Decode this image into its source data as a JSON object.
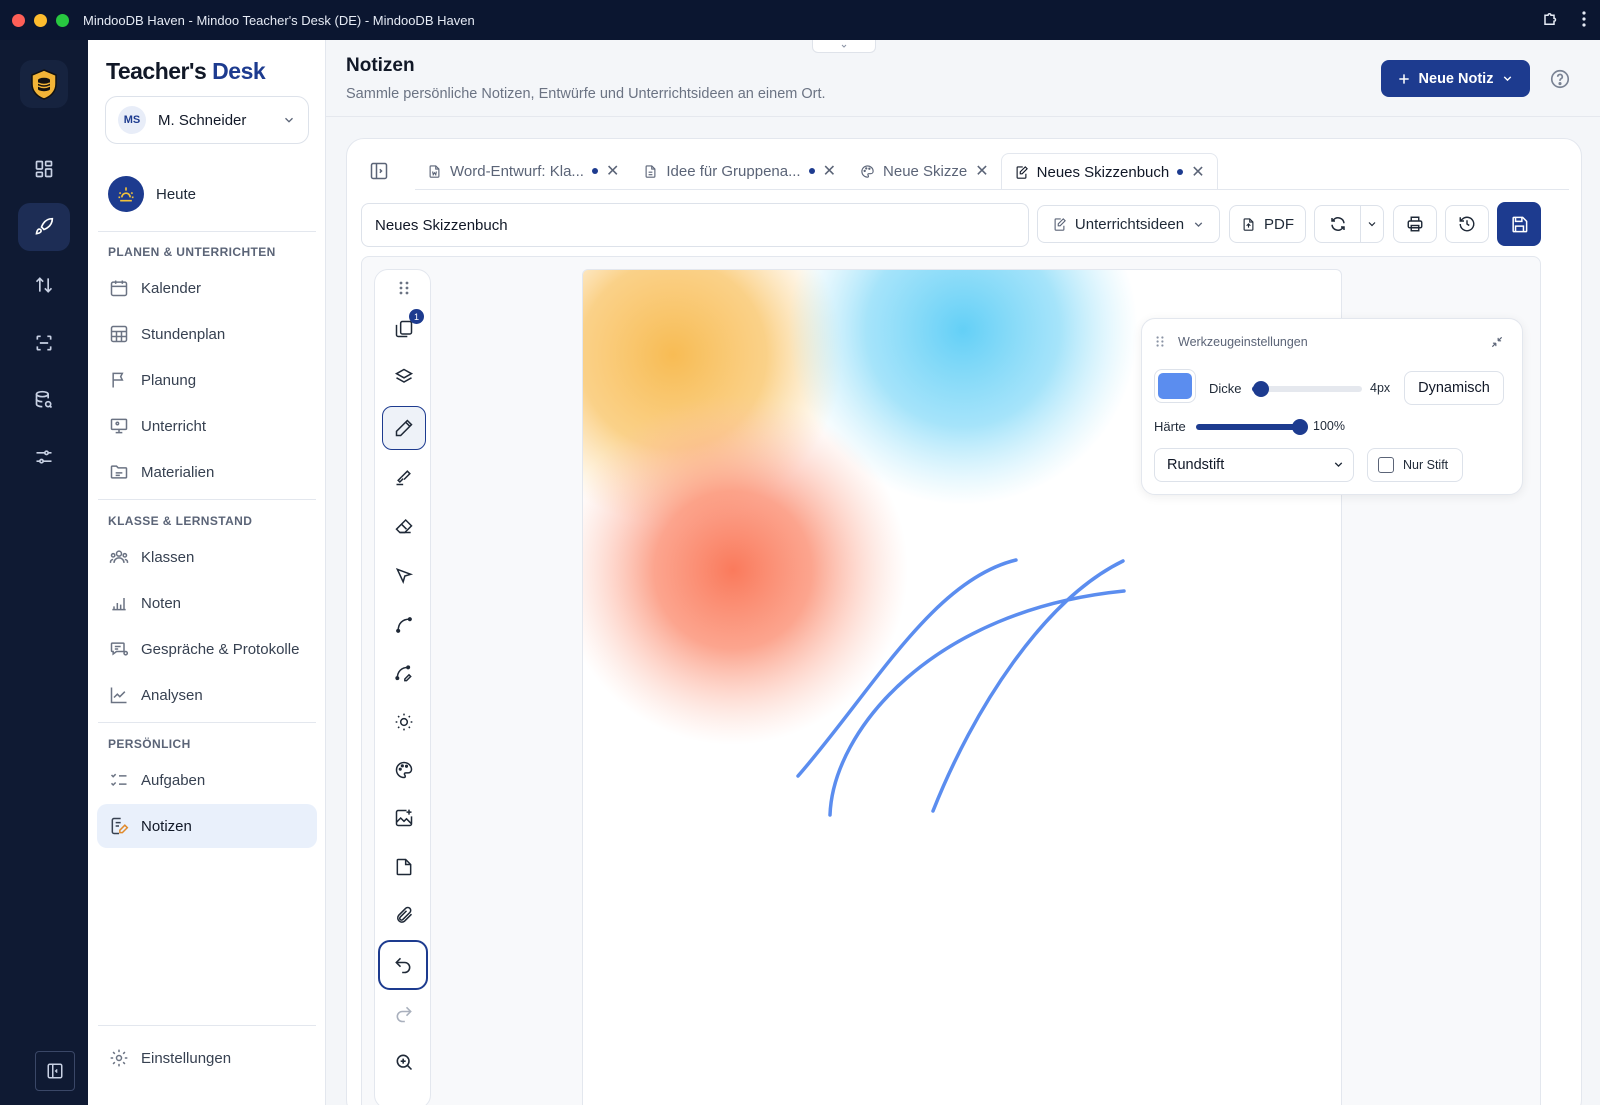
{
  "window": {
    "title": "MindooDB Haven - Mindoo Teacher's Desk (DE) - MindooDB Haven"
  },
  "sidebar": {
    "brand_part1": "Teacher's",
    "brand_part2": "Desk",
    "user": {
      "initials": "MS",
      "name": "M. Schneider"
    },
    "today_label": "Heute",
    "section1": "PLANEN & UNTERRICHTEN",
    "section2": "KLASSE & LERNSTAND",
    "section3": "PERSÖNLICH",
    "items": [
      {
        "label": "Kalender"
      },
      {
        "label": "Stundenplan"
      },
      {
        "label": "Planung"
      },
      {
        "label": "Unterricht"
      },
      {
        "label": "Materialien"
      },
      {
        "label": "Klassen"
      },
      {
        "label": "Noten"
      },
      {
        "label": "Gespräche & Protokolle"
      },
      {
        "label": "Analysen"
      },
      {
        "label": "Aufgaben"
      },
      {
        "label": "Notizen"
      }
    ],
    "settings_label": "Einstellungen"
  },
  "header": {
    "title": "Notizen",
    "subtitle": "Sammle persönliche Notizen, Entwürfe und Unterrichtsideen an einem Ort.",
    "new_button": "Neue Notiz"
  },
  "tabs": [
    {
      "label": "Word-Entwurf: Kla...",
      "unsaved": true
    },
    {
      "label": "Idee für Gruppena...",
      "unsaved": true
    },
    {
      "label": "Neue Skizze",
      "unsaved": false
    },
    {
      "label": "Neues Skizzenbuch",
      "unsaved": true
    }
  ],
  "editor": {
    "name_value": "Neues Skizzenbuch",
    "category": "Unterrichtsideen",
    "pdf_label": "PDF",
    "pages_badge": "1"
  },
  "tool_settings": {
    "title": "Werkzeugeinstellungen",
    "color": "#5b8def",
    "thickness_label": "Dicke",
    "thickness_value": "4px",
    "thickness_fraction": 0.08,
    "dynamic_label": "Dynamisch",
    "hardness_label": "Härte",
    "hardness_value": "100%",
    "hardness_fraction": 1.0,
    "brush": "Rundstift",
    "pen_only_label": "Nur Stift",
    "pen_only_checked": false
  },
  "colors": {
    "accent": "#1d3b8f",
    "stroke": "#5b8def",
    "blob_orange": "#f7b84b",
    "blob_blue": "#5bcdf6",
    "blob_red": "#fa7a5c"
  }
}
